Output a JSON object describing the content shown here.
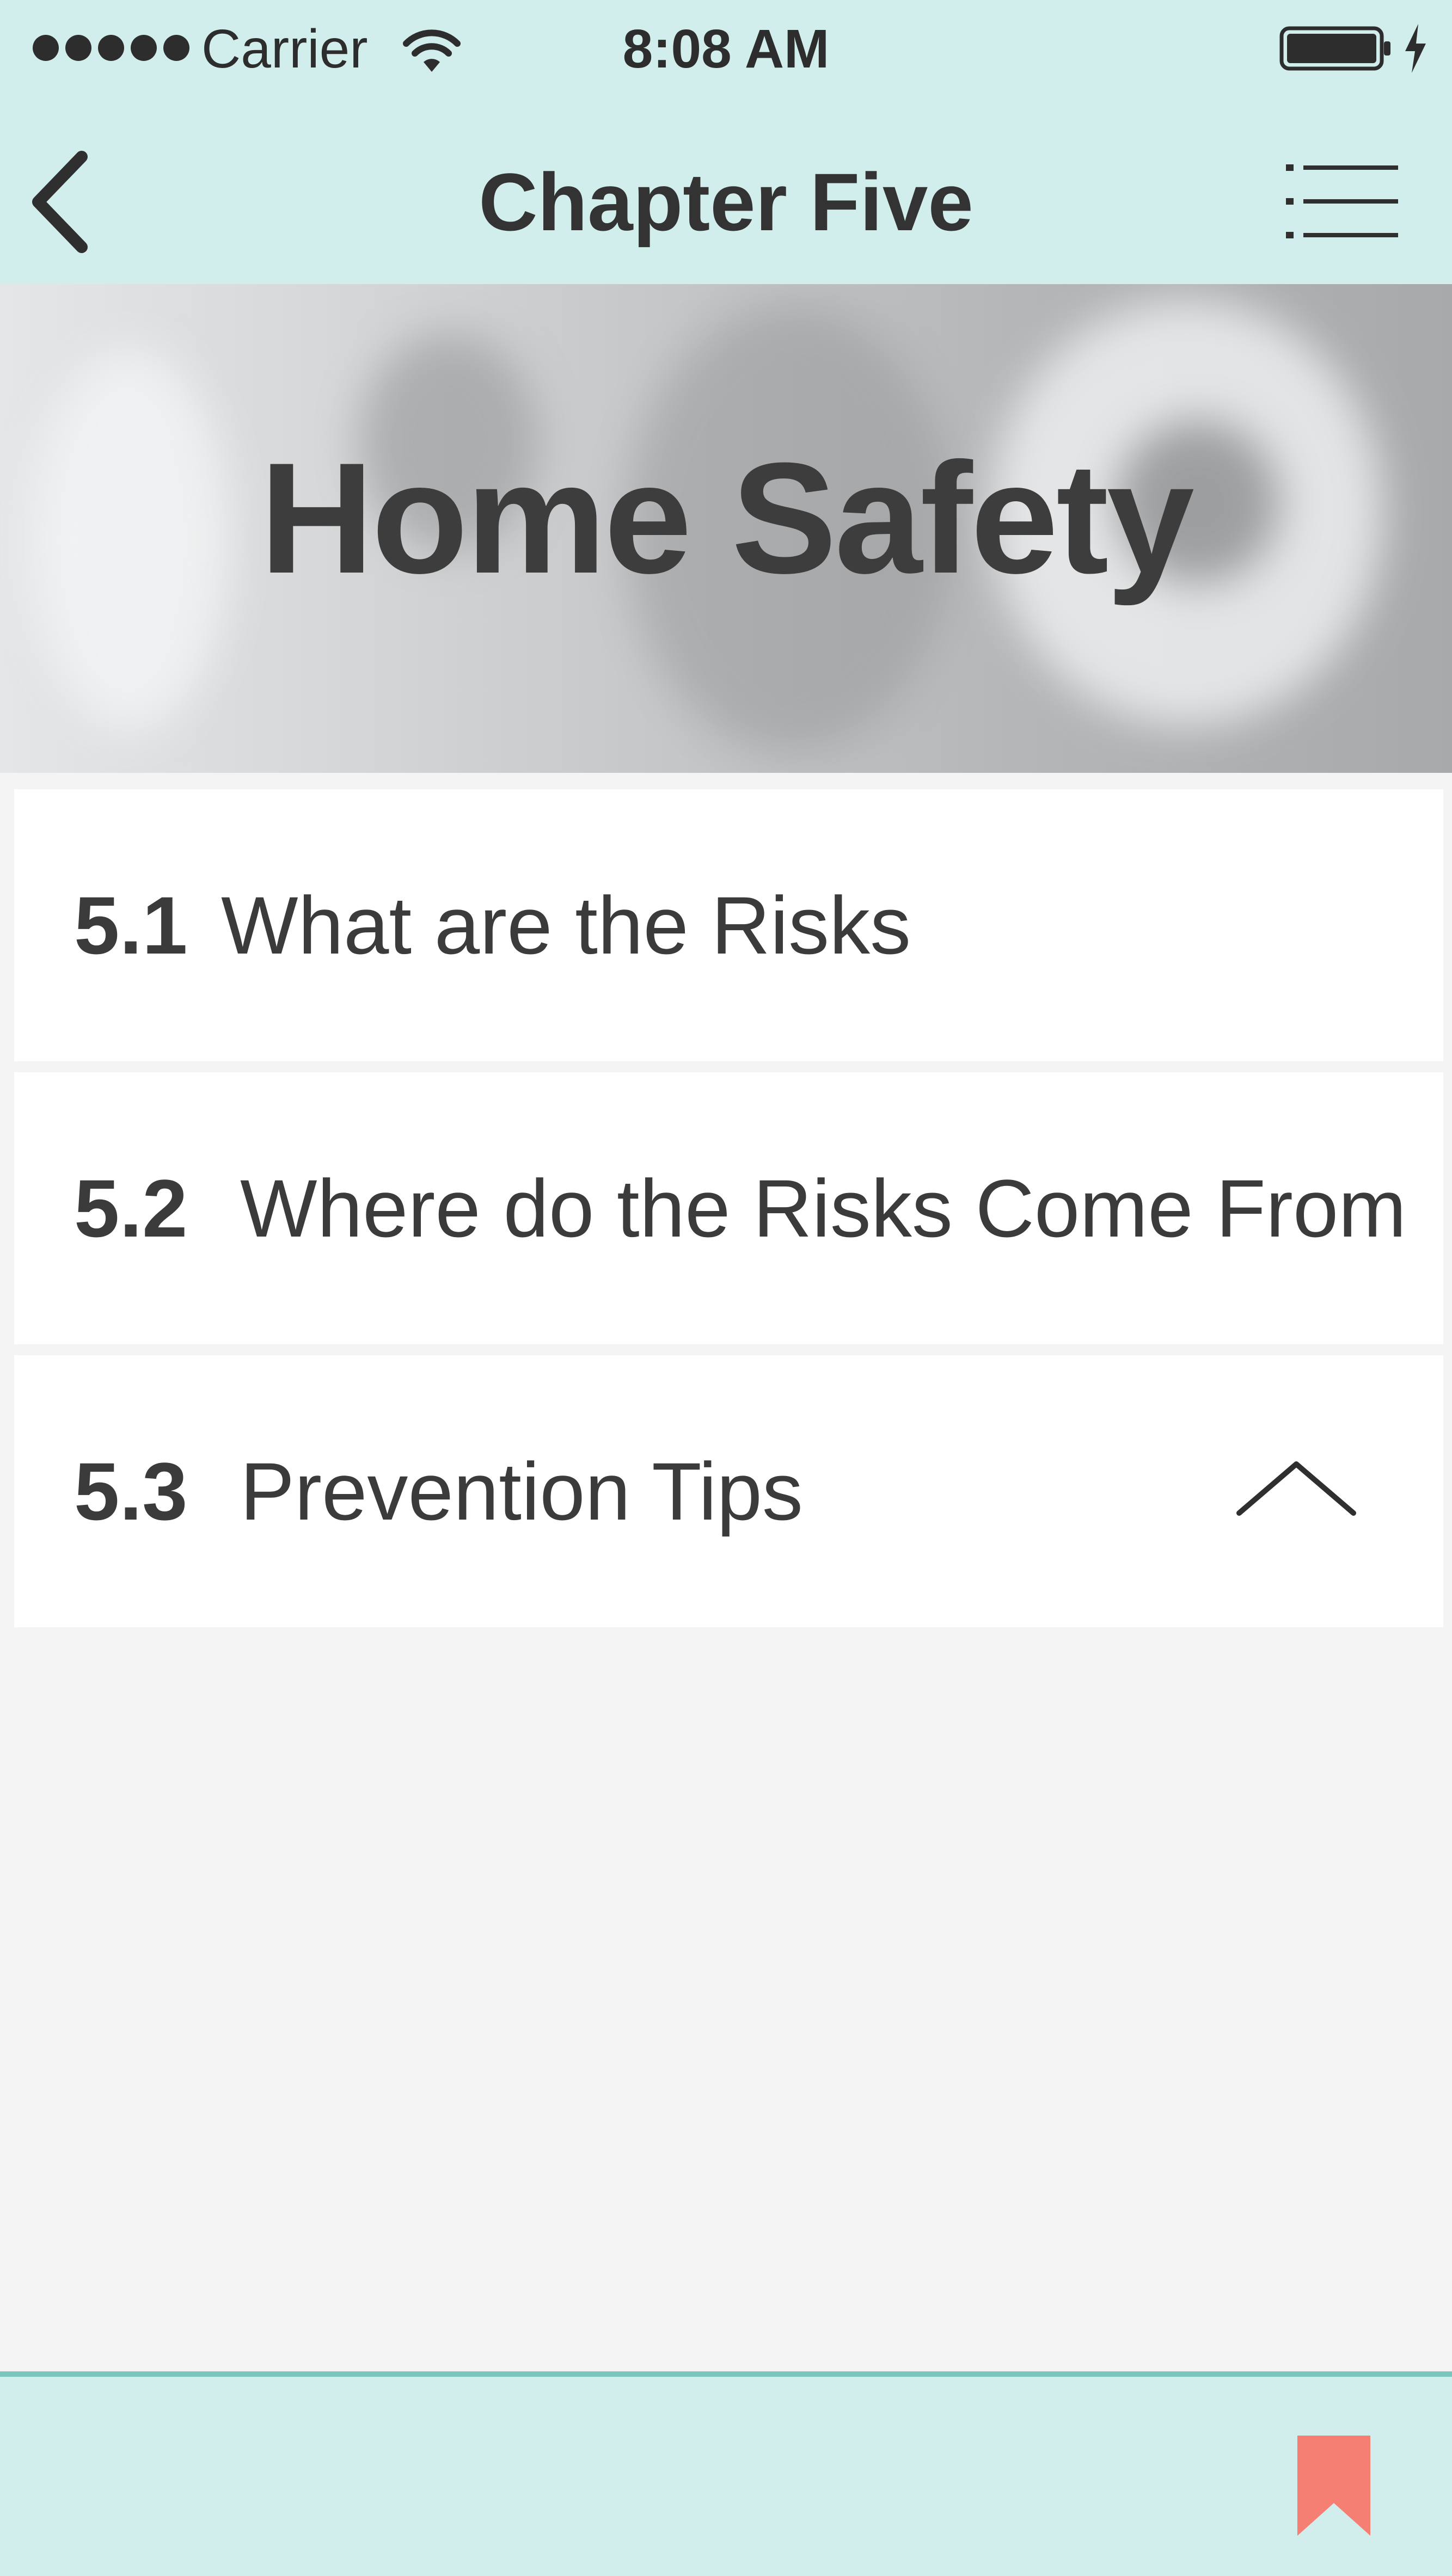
{
  "status_bar": {
    "carrier": "Carrier",
    "time": "8:08 AM",
    "signal_icon": "signal-dots-icon",
    "wifi_icon": "wifi-icon",
    "battery_icon": "battery-icon",
    "charging_icon": "charging-bolt-icon"
  },
  "nav": {
    "title": "Chapter Five",
    "back_icon": "chevron-left-icon",
    "menu_icon": "list-menu-icon"
  },
  "hero": {
    "title": "Home Safety"
  },
  "sections": [
    {
      "number": "5.1",
      "title": "What are the Risks"
    },
    {
      "number": "5.2",
      "title": "Where do the Risks Come From"
    },
    {
      "number": "5.3",
      "title": "Prevention Tips",
      "expanded": true,
      "icon": "chevron-up-icon"
    }
  ],
  "bottom_bar": {
    "bookmark_icon": "bookmark-icon"
  },
  "colors": {
    "bar_background": "#d1eeec",
    "bar_border": "#7dc4bc",
    "bookmark": "#f47f72",
    "text": "#3b3b3b",
    "page_background": "#f4f4f4"
  }
}
